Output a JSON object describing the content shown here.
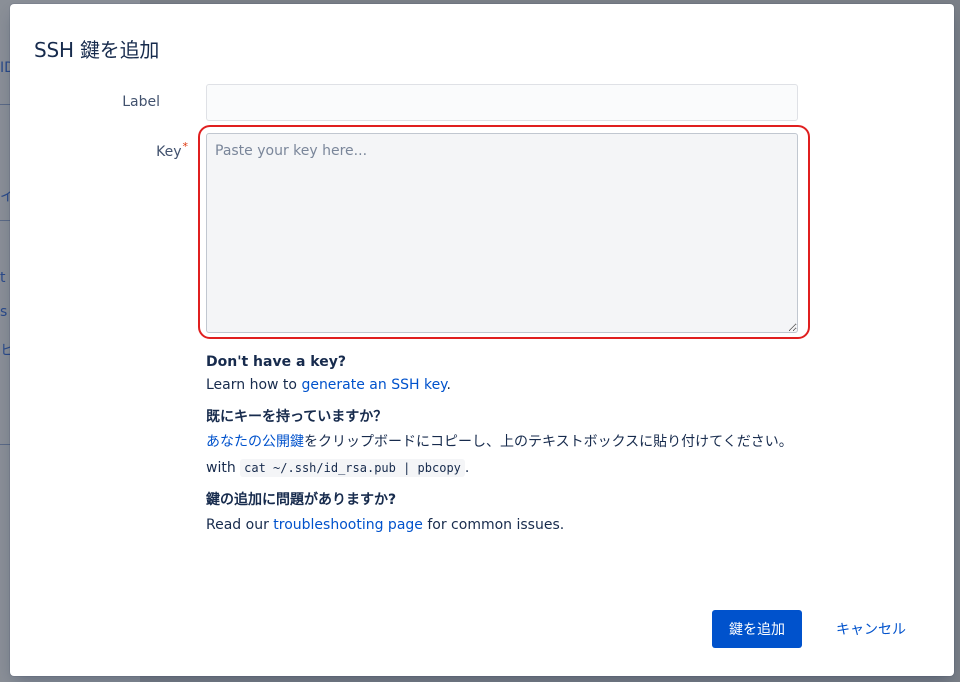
{
  "background": {
    "hints": [
      "ID",
      "イ",
      "t",
      "s",
      "ヒ"
    ]
  },
  "modal": {
    "title": "SSH 鍵を追加",
    "fields": {
      "label": {
        "label": "Label",
        "value": "",
        "placeholder": ""
      },
      "key": {
        "label": "Key",
        "required_marker": "*",
        "value": "",
        "placeholder": "Paste your key here..."
      }
    },
    "help": {
      "no_key_heading": "Don't have a key?",
      "no_key_text_prefix": "Learn how to ",
      "no_key_link": "generate an SSH key",
      "no_key_text_suffix": ".",
      "have_key_heading": "既にキーを持っていますか？",
      "have_key_link": "あなたの公開鍵",
      "have_key_text": "をクリップボードにコピーし、上のテキストボックスに貼り付けてください。",
      "with_prefix": "with ",
      "command": "cat ~/.ssh/id_rsa.pub | pbcopy",
      "with_suffix": ".",
      "problem_heading": "鍵の追加に問題がありますか?",
      "problem_text_prefix": "Read our ",
      "problem_link": "troubleshooting page",
      "problem_text_suffix": " for common issues."
    },
    "buttons": {
      "submit": "鍵を追加",
      "cancel": "キャンセル"
    }
  },
  "colors": {
    "primary": "#0052cc",
    "highlight": "#e01f1f",
    "required": "#de350b"
  }
}
